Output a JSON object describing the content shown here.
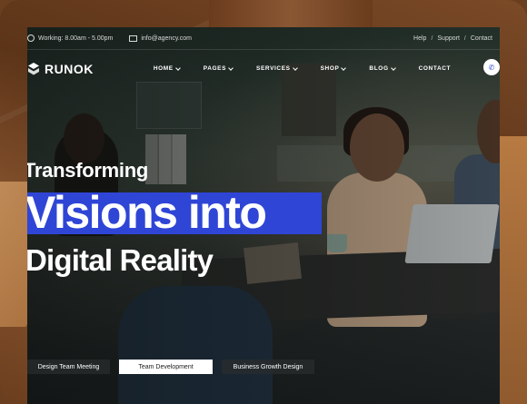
{
  "topbar": {
    "hours": "Working: 8.00am - 5.00pm",
    "email": "info@agency.com",
    "links": [
      "Help",
      "Support",
      "Contact"
    ],
    "separator": "/"
  },
  "brand": {
    "name": "RUNOK",
    "accent": "#2f45d6"
  },
  "nav": {
    "items": [
      {
        "label": "HOME",
        "dropdown": true
      },
      {
        "label": "PAGES",
        "dropdown": true
      },
      {
        "label": "SERVICES",
        "dropdown": true
      },
      {
        "label": "SHOP",
        "dropdown": true
      },
      {
        "label": "BLOG",
        "dropdown": true
      },
      {
        "label": "CONTACT",
        "dropdown": false
      }
    ],
    "phone_icon": "phone-icon"
  },
  "hero": {
    "line1": "Transforming",
    "line2": "Visions into",
    "line3": "Digital Reality"
  },
  "tabs": [
    {
      "label": "Design Team Meeting",
      "active": false
    },
    {
      "label": "Team Development",
      "active": true
    },
    {
      "label": "Business Growth Design",
      "active": false
    }
  ]
}
